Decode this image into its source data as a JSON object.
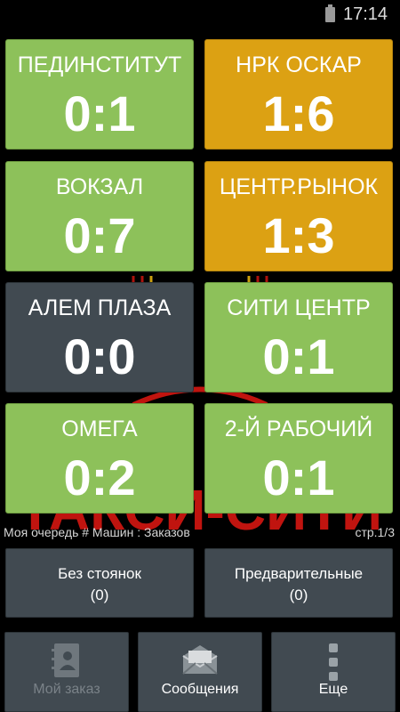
{
  "status_bar": {
    "time": "17:14"
  },
  "tiles": [
    {
      "name": "ПЕДИНСТИТУТ",
      "score": "0:1",
      "color": "#8dc15a"
    },
    {
      "name": "НРК ОСКАР",
      "score": "1:6",
      "color": "#dca113"
    },
    {
      "name": "ВОКЗАЛ",
      "score": "0:7",
      "color": "#8dc15a"
    },
    {
      "name": "ЦЕНТР.РЫНОК",
      "score": "1:3",
      "color": "#dca113"
    },
    {
      "name": "АЛЕМ ПЛАЗА",
      "score": "0:0",
      "color": "#414a51"
    },
    {
      "name": "СИТИ ЦЕНТР",
      "score": "0:1",
      "color": "#8dc15a"
    },
    {
      "name": "ОМЕГА",
      "score": "0:2",
      "color": "#8dc15a"
    },
    {
      "name": "2-Й РАБОЧИЙ",
      "score": "0:1",
      "color": "#8dc15a"
    }
  ],
  "info": {
    "queue_text": "Моя очередь # Машин : Заказов",
    "page_text": "стр.1/3"
  },
  "middle_buttons": [
    {
      "line1": "Без стоянок",
      "line2": "(0)"
    },
    {
      "line1": "Предварительные",
      "line2": "(0)"
    }
  ],
  "nav_buttons": [
    {
      "label": "Мой заказ",
      "icon": "contacts-book-icon",
      "enabled": false
    },
    {
      "label": "Сообщения",
      "icon": "envelope-icon",
      "enabled": true
    },
    {
      "label": "Еще",
      "icon": "more-vertical-icon",
      "enabled": true
    }
  ],
  "background_logo": {
    "text": "ТАКСИ-СИТИ",
    "color": "#c0140f"
  }
}
